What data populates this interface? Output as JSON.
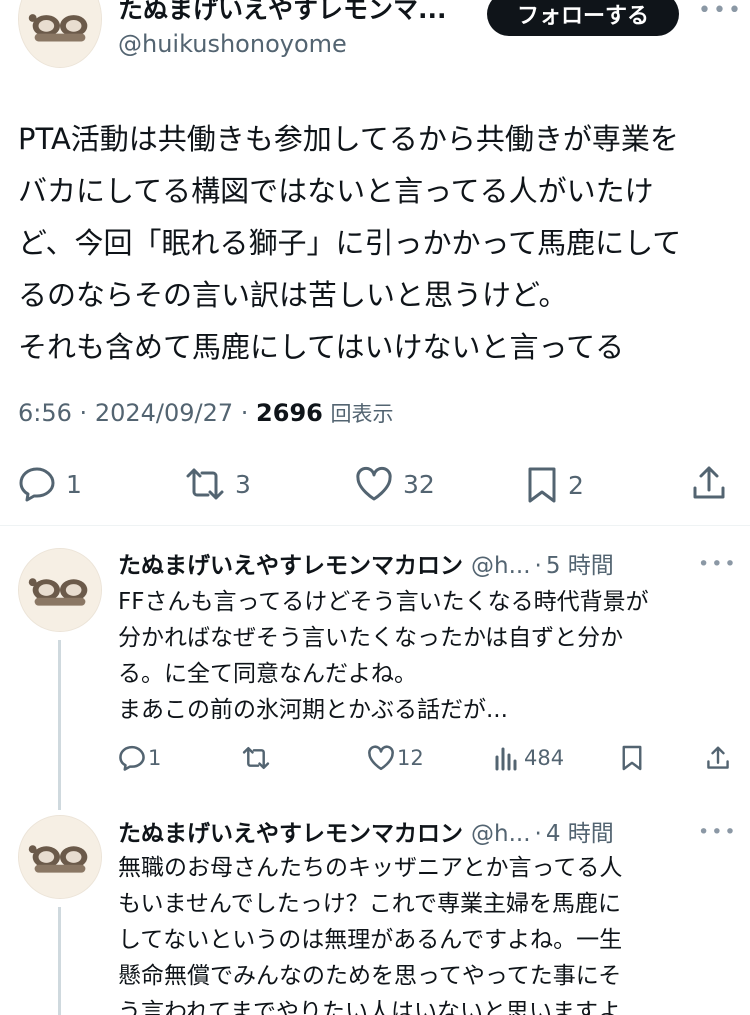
{
  "main_tweet": {
    "display_name": "たぬまげいえやすレモンマ...",
    "handle": "@huikushonoyome",
    "follow_label": "フォローする",
    "text_lines": [
      "PTA活動は共働きも参加してるから共働きが専業を",
      "バカにしてる構図ではないと言ってる人がいたけ",
      "ど、今回「眠れる獅子」に引っかかって馬鹿にして",
      "るのならその言い訳は苦しいと思うけど。",
      "それも含めて馬鹿にしてはいけないと言ってる"
    ],
    "time": "6:56",
    "date": "2024/09/27",
    "views_count": "2696",
    "views_label": "回表示",
    "stats": {
      "replies": "1",
      "retweets": "3",
      "likes": "32",
      "bookmarks": "2"
    }
  },
  "replies": [
    {
      "display_name": "たぬまげいえやすレモンマカロン",
      "handle": "@h...",
      "time_ago": "5 時間",
      "text_lines": [
        "FFさんも言ってるけどそう言いたくなる時代背景が",
        "分かればなぜそう言いたくなったかは自ずと分か",
        "る。に全て同意なんだよね。",
        "まあこの前の氷河期とかぶる話だが..."
      ],
      "stats": {
        "replies": "1",
        "retweets": "",
        "likes": "12",
        "views": "484"
      }
    },
    {
      "display_name": "たぬまげいえやすレモンマカロン",
      "handle": "@h...",
      "time_ago": "4 時間",
      "text_lines": [
        "無職のお母さんたちのキッザニアとか言ってる人",
        "もいませんでしたっけ？これで専業主婦を馬鹿に",
        "してないというのは無理があるんですよね。一生",
        "懸命無償でみんなのためを思ってやってた事にそ",
        "う言われてまでやりたい人はいないと思いますよ"
      ]
    }
  ],
  "icons": [
    "avatar-raccoon",
    "more-icon",
    "reply-icon",
    "retweet-icon",
    "like-icon",
    "bookmark-icon",
    "share-icon",
    "views-icon"
  ],
  "colors": {
    "text": "#0f1419",
    "secondary": "#536471",
    "button_bg": "#0f1419",
    "divider": "#eff3f4",
    "thread_line": "#cfd9de"
  }
}
